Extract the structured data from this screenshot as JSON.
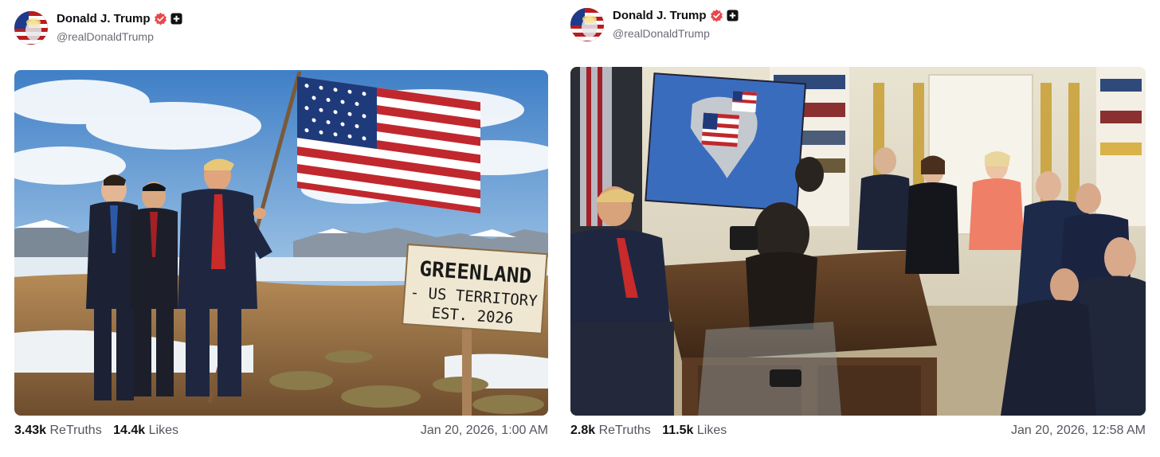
{
  "posts": [
    {
      "author": {
        "name": "Donald J. Trump",
        "handle": "@realDonaldTrump",
        "avatar_icon": "flag-portrait-avatar"
      },
      "image": {
        "description_icon": "ai-image-greenland-flag",
        "sign_lines": [
          "GREENLAND",
          "- US TERRITORY",
          "EST. 2026"
        ]
      },
      "stats": {
        "retruths_value": "3.43k",
        "retruths_label": "ReTruths",
        "likes_value": "14.4k",
        "likes_label": "Likes"
      },
      "timestamp": "Jan 20, 2026, 1:00 AM"
    },
    {
      "author": {
        "name": "Donald J. Trump",
        "handle": "@realDonaldTrump",
        "avatar_icon": "flag-portrait-avatar"
      },
      "image": {
        "description_icon": "oval-office-meeting-photo"
      },
      "stats": {
        "retruths_value": "2.8k",
        "retruths_label": "ReTruths",
        "likes_value": "11.5k",
        "likes_label": "Likes"
      },
      "timestamp": "Jan 20, 2026, 12:58 AM"
    }
  ],
  "colors": {
    "verified": "#e8474c",
    "text_primary": "#0f0f14",
    "text_secondary": "#55555f"
  }
}
